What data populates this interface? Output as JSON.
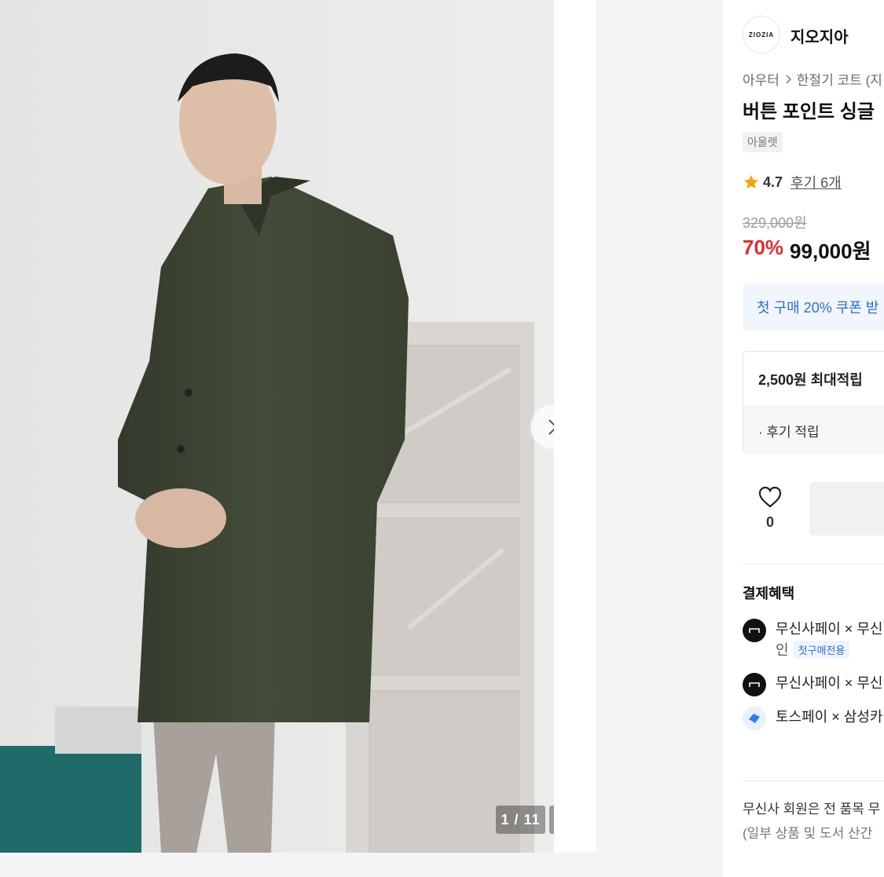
{
  "gallery": {
    "counter": "1 / 11",
    "next_icon": "chevron-right-icon",
    "expand_icon": "expand-icon",
    "alt": "Model wearing an olive green single coat"
  },
  "brand": {
    "logo_text": "ZIOZIA",
    "name": "지오지아"
  },
  "breadcrumb": [
    "아우터",
    "한절기 코트 (지"
  ],
  "product": {
    "title": "버튼 포인트 싱글",
    "tag": "아울렛",
    "rating": "4.7",
    "reviews": "후기 6개",
    "original_price": "329,000원",
    "discount": "70%",
    "price": "99,000원"
  },
  "coupon": {
    "text": "첫 구매 20% 쿠폰 받"
  },
  "points": {
    "title": "2,500원 최대적립",
    "item": "· 후기 적립"
  },
  "like": {
    "count": "0"
  },
  "payment": {
    "title": "결제혜택",
    "rows": [
      {
        "text": "무신사페이 × 무신",
        "sub": "인",
        "badge": "첫구매전용"
      },
      {
        "text": "무신사페이 × 무신"
      },
      {
        "text": "토스페이 × 삼성카"
      }
    ]
  },
  "notice": {
    "line1": "무신사 회원은 전 품목 무",
    "line2": "(일부 상품 및 도서 산간"
  },
  "colors": {
    "sale": "#e02c2c",
    "coupon_text": "#2c6fd6",
    "star": "#f7a600"
  }
}
